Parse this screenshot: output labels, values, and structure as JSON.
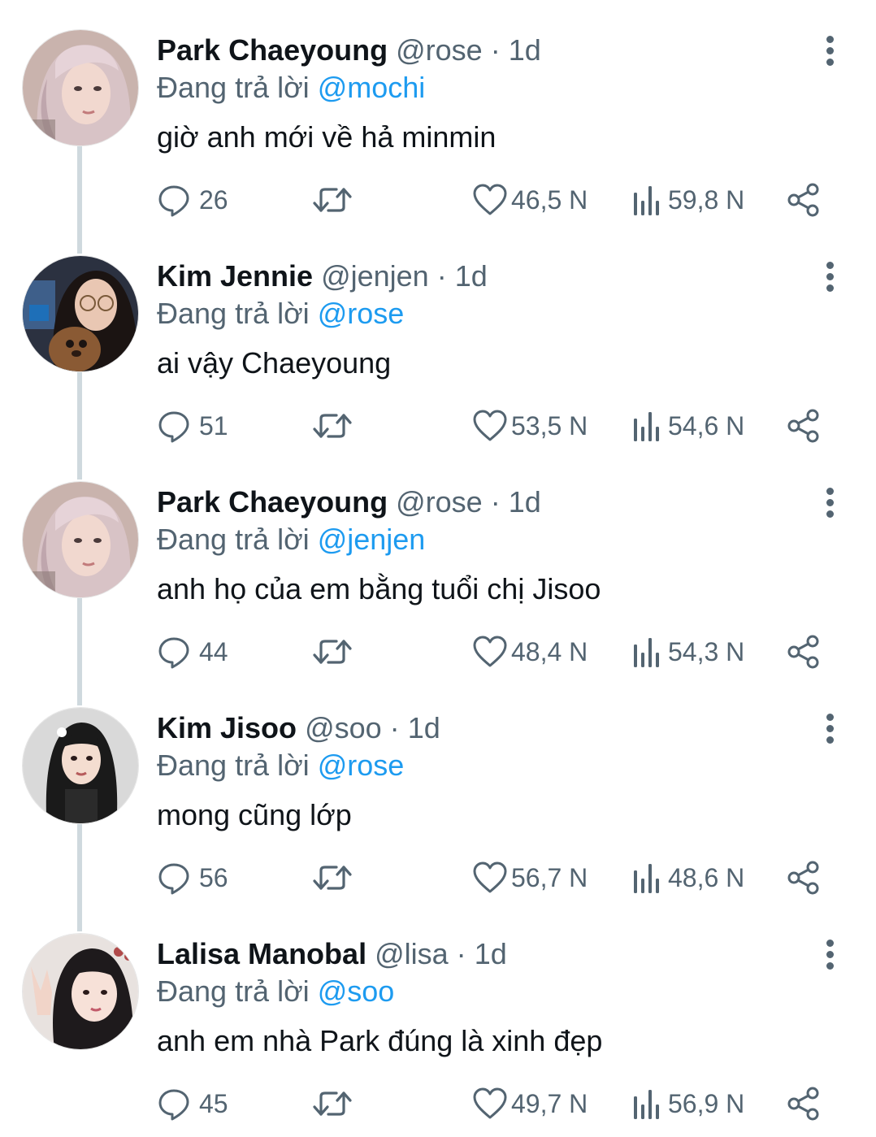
{
  "reply_prefix": "Đang trả lời",
  "separator": "·",
  "tweets": [
    {
      "name": "Park Chaeyoung",
      "handle": "@rose",
      "time": "1d",
      "reply_to": "@mochi",
      "text": "giờ anh mới về hả minmin",
      "replies": "26",
      "likes": "46,5 N",
      "views": "59,8 N",
      "avatar": "rose-avatar"
    },
    {
      "name": "Kim Jennie",
      "handle": "@jenjen",
      "time": "1d",
      "reply_to": "@rose",
      "text": "ai vậy Chaeyoung",
      "replies": "51",
      "likes": "53,5 N",
      "views": "54,6 N",
      "avatar": "jennie-avatar"
    },
    {
      "name": "Park Chaeyoung",
      "handle": "@rose",
      "time": "1d",
      "reply_to": "@jenjen",
      "text": "anh họ của em bằng tuổi chị Jisoo",
      "replies": "44",
      "likes": "48,4 N",
      "views": "54,3 N",
      "avatar": "rose-avatar"
    },
    {
      "name": "Kim Jisoo",
      "handle": "@soo",
      "time": "1d",
      "reply_to": "@rose",
      "text": "mong cũng lớp",
      "replies": "56",
      "likes": "56,7 N",
      "views": "48,6 N",
      "avatar": "jisoo-avatar"
    },
    {
      "name": "Lalisa Manobal",
      "handle": "@lisa",
      "time": "1d",
      "reply_to": "@soo",
      "text": "anh em nhà Park đúng là xinh đẹp",
      "replies": "45",
      "likes": "49,7 N",
      "views": "56,9 N",
      "avatar": "lisa-avatar"
    }
  ],
  "colors": {
    "text": "#0f1419",
    "secondary": "#536471",
    "mention": "#1d9bf0",
    "thread_line": "#cfd9de"
  }
}
